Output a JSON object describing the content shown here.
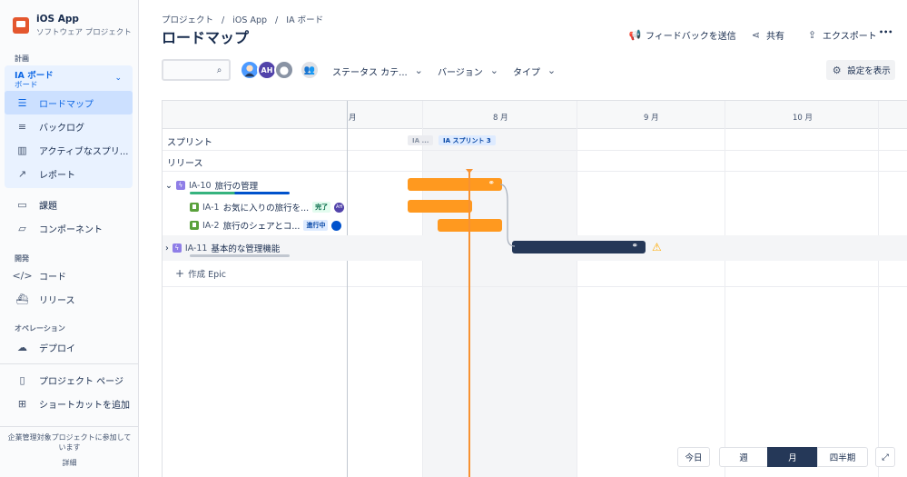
{
  "sidebar": {
    "project_name": "iOS App",
    "project_type": "ソフトウェア プロジェクト",
    "section_planning": "計画",
    "board_title": "IA ボード",
    "board_subtitle": "ボード",
    "items_board": [
      {
        "label": "ロードマップ",
        "icon": "roadmap-icon",
        "active": true
      },
      {
        "label": "バックログ",
        "icon": "backlog-icon"
      },
      {
        "label": "アクティブなスプリ...",
        "icon": "board-icon"
      },
      {
        "label": "レポート",
        "icon": "chart-icon"
      }
    ],
    "items_plan": [
      {
        "label": "課題",
        "icon": "issues-icon"
      },
      {
        "label": "コンポーネント",
        "icon": "component-icon"
      }
    ],
    "section_dev": "開発",
    "items_dev": [
      {
        "label": "コード",
        "icon": "code-icon"
      },
      {
        "label": "リリース",
        "icon": "ship-icon"
      }
    ],
    "section_ops": "オペレーション",
    "items_ops": [
      {
        "label": "デプロイ",
        "icon": "cloud-icon"
      }
    ],
    "items_bottom": [
      {
        "label": "プロジェクト ページ",
        "icon": "page-icon"
      },
      {
        "label": "ショートカットを追加",
        "icon": "add-shortcut-icon"
      }
    ],
    "footer_text": "企業管理対象プロジェクトに参加しています",
    "footer_link": "詳細"
  },
  "header": {
    "breadcrumbs": [
      "プロジェクト",
      "/",
      "iOS App",
      "/",
      "IA ボード"
    ],
    "title": "ロードマップ",
    "feedback": "フィードバックを送信",
    "share": "共有",
    "export": "エクスポート",
    "more": "•••"
  },
  "toolbar": {
    "search_placeholder": "",
    "avatar_ah": "AH",
    "filter_status": "ステータス カテ...",
    "filter_version": "バージョン",
    "filter_type": "タイプ",
    "settings": "設定を表示"
  },
  "roadmap": {
    "months": [
      "月",
      "8 月",
      "9 月",
      "10 月"
    ],
    "row_sprint": "スプリント",
    "row_release": "リリース",
    "sprint_prev": "IA ...",
    "sprint_current": "IA スプリント 3",
    "epics": [
      {
        "key": "IA-10",
        "title": "旅行の管理",
        "expanded": "⌄"
      },
      {
        "key": "IA-11",
        "title": "基本的な管理機能",
        "expanded": "›"
      }
    ],
    "stories": [
      {
        "key": "IA-1",
        "title": "お気に入りの旅行を...",
        "status": "完了",
        "assignee": "AH"
      },
      {
        "key": "IA-2",
        "title": "旅行のシェアとコ...",
        "status": "進行中"
      }
    ],
    "create_epic": "作成 Epic",
    "colors": {
      "orange": "#ff991f",
      "navy": "#253858",
      "today": "#f79232"
    }
  },
  "controls": {
    "today": "今日",
    "week": "週",
    "month": "月",
    "quarter": "四半期",
    "selected": "月"
  }
}
